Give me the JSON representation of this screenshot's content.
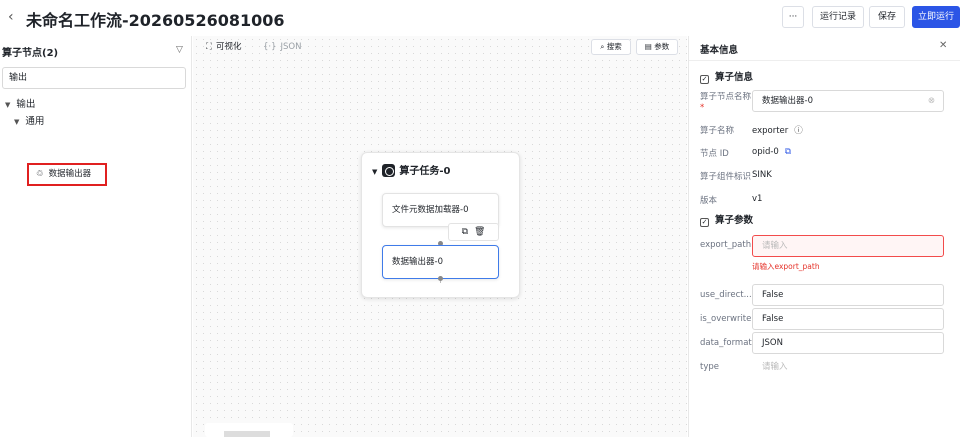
{
  "header": {
    "back_icon": "‹",
    "title": "未命名工作流-20260526081006",
    "more": "···",
    "run_record": "运行记录",
    "save": "保存",
    "run_now": "立即运行",
    "accent": "#2b55e6"
  },
  "left": {
    "title": "算子节点(2)",
    "filter_icon": "▽",
    "search_value": "输出",
    "tree": {
      "root": "输出",
      "child": "通用",
      "leaf": "数据输出器"
    }
  },
  "canvas": {
    "tab_visual": "可视化",
    "tab_json": "JSON",
    "search": "搜索",
    "params": "参数",
    "group": {
      "title": "算子任务-0",
      "nodes": [
        "文件元数据加载器-0",
        "数据输出器-0"
      ],
      "actions": [
        "⧉",
        "🗑"
      ]
    }
  },
  "panel": {
    "title": "基本信息",
    "close": "✕",
    "section_operator": "算子信息",
    "node_name_label": "算子节点名称",
    "node_name_value": "数据输出器-0",
    "op_name_label": "算子名称",
    "op_name_value": "exporter",
    "node_id_label": "节点 ID",
    "node_id_value": "opid-0",
    "comp_label": "算子组件标识",
    "comp_value": "SINK",
    "version_label": "版本",
    "version_value": "v1",
    "section_params": "算子参数",
    "params": [
      {
        "label": "export_path",
        "value": "",
        "placeholder": "请输入",
        "error": "请输入export_path"
      },
      {
        "label": "use_direct...",
        "value": "False"
      },
      {
        "label": "is_overwrite",
        "value": "False"
      },
      {
        "label": "data_format",
        "value": "JSON"
      },
      {
        "label": "type",
        "value": "",
        "placeholder": "请输入"
      }
    ]
  }
}
